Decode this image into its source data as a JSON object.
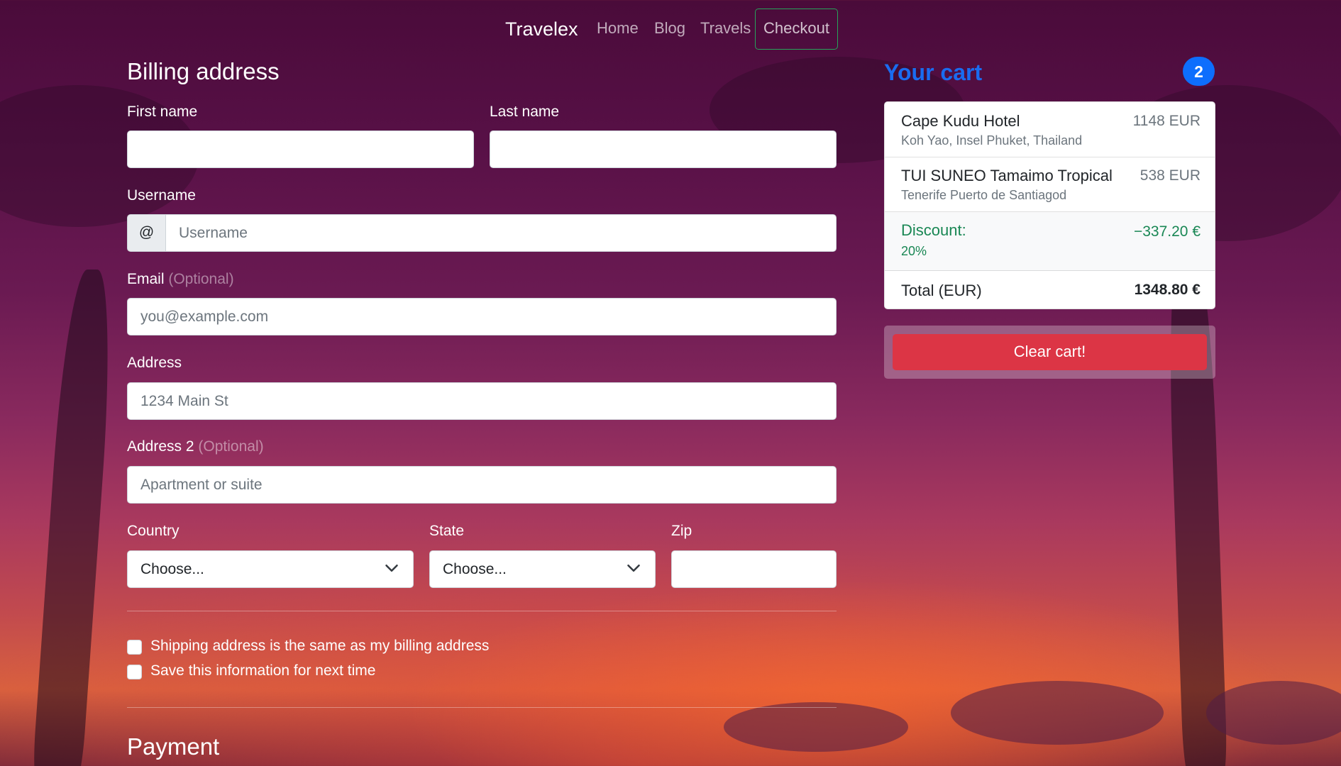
{
  "nav": {
    "brand": "Travelex",
    "links": [
      "Home",
      "Blog",
      "Travels",
      "Checkout"
    ]
  },
  "billing": {
    "title": "Billing address",
    "first_name_label": "First name",
    "last_name_label": "Last name",
    "username_label": "Username",
    "username_prefix": "@",
    "username_placeholder": "Username",
    "email_label": "Email",
    "email_optional": "(Optional)",
    "email_placeholder": "you@example.com",
    "address_label": "Address",
    "address_placeholder": "1234 Main St",
    "address2_label": "Address 2",
    "address2_optional": "(Optional)",
    "address2_placeholder": "Apartment or suite",
    "country_label": "Country",
    "country_value": "Choose...",
    "state_label": "State",
    "state_value": "Choose...",
    "zip_label": "Zip",
    "shipping_same_label": "Shipping address is the same as my billing address",
    "save_info_label": "Save this information for next time"
  },
  "payment": {
    "title": "Payment"
  },
  "cart": {
    "title": "Your cart",
    "count": "2",
    "items": [
      {
        "name": "Cape Kudu Hotel",
        "location": "Koh Yao, Insel Phuket, Thailand",
        "price": "1148 EUR"
      },
      {
        "name": "TUI SUNEO Tamaimo Tropical",
        "location": "Tenerife Puerto de Santiagod",
        "price": "538 EUR"
      }
    ],
    "discount": {
      "label": "Discount:",
      "percent": "20%",
      "amount": "−337.20 €"
    },
    "total": {
      "label": "Total (EUR)",
      "amount": "1348.80 €"
    },
    "clear_label": "Clear cart!"
  },
  "colors": {
    "accent": "#0d6efd",
    "danger": "#dc3545",
    "success": "#198754"
  }
}
